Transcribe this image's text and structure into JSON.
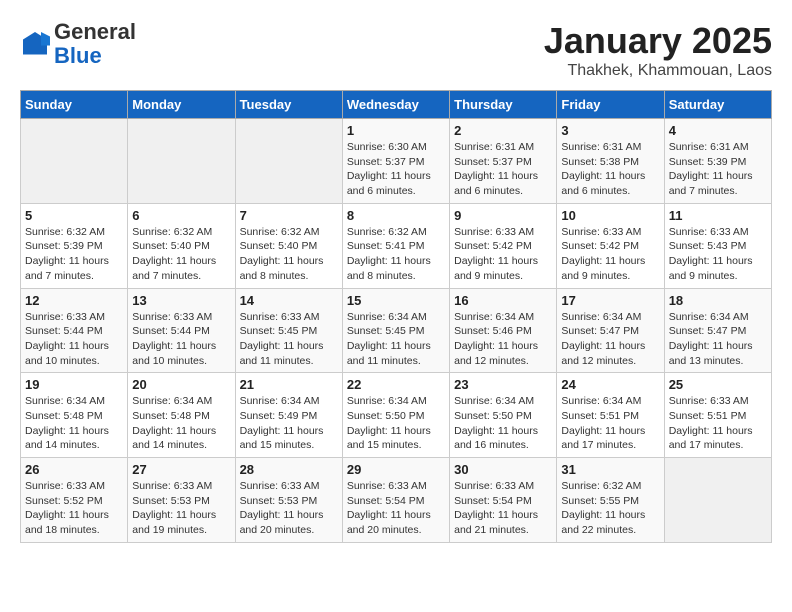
{
  "header": {
    "logo_line1": "General",
    "logo_line2": "Blue",
    "title": "January 2025",
    "subtitle": "Thakhek, Khammouan, Laos"
  },
  "weekdays": [
    "Sunday",
    "Monday",
    "Tuesday",
    "Wednesday",
    "Thursday",
    "Friday",
    "Saturday"
  ],
  "weeks": [
    [
      {
        "day": "",
        "info": ""
      },
      {
        "day": "",
        "info": ""
      },
      {
        "day": "",
        "info": ""
      },
      {
        "day": "1",
        "info": "Sunrise: 6:30 AM\nSunset: 5:37 PM\nDaylight: 11 hours\nand 6 minutes."
      },
      {
        "day": "2",
        "info": "Sunrise: 6:31 AM\nSunset: 5:37 PM\nDaylight: 11 hours\nand 6 minutes."
      },
      {
        "day": "3",
        "info": "Sunrise: 6:31 AM\nSunset: 5:38 PM\nDaylight: 11 hours\nand 6 minutes."
      },
      {
        "day": "4",
        "info": "Sunrise: 6:31 AM\nSunset: 5:39 PM\nDaylight: 11 hours\nand 7 minutes."
      }
    ],
    [
      {
        "day": "5",
        "info": "Sunrise: 6:32 AM\nSunset: 5:39 PM\nDaylight: 11 hours\nand 7 minutes."
      },
      {
        "day": "6",
        "info": "Sunrise: 6:32 AM\nSunset: 5:40 PM\nDaylight: 11 hours\nand 7 minutes."
      },
      {
        "day": "7",
        "info": "Sunrise: 6:32 AM\nSunset: 5:40 PM\nDaylight: 11 hours\nand 8 minutes."
      },
      {
        "day": "8",
        "info": "Sunrise: 6:32 AM\nSunset: 5:41 PM\nDaylight: 11 hours\nand 8 minutes."
      },
      {
        "day": "9",
        "info": "Sunrise: 6:33 AM\nSunset: 5:42 PM\nDaylight: 11 hours\nand 9 minutes."
      },
      {
        "day": "10",
        "info": "Sunrise: 6:33 AM\nSunset: 5:42 PM\nDaylight: 11 hours\nand 9 minutes."
      },
      {
        "day": "11",
        "info": "Sunrise: 6:33 AM\nSunset: 5:43 PM\nDaylight: 11 hours\nand 9 minutes."
      }
    ],
    [
      {
        "day": "12",
        "info": "Sunrise: 6:33 AM\nSunset: 5:44 PM\nDaylight: 11 hours\nand 10 minutes."
      },
      {
        "day": "13",
        "info": "Sunrise: 6:33 AM\nSunset: 5:44 PM\nDaylight: 11 hours\nand 10 minutes."
      },
      {
        "day": "14",
        "info": "Sunrise: 6:33 AM\nSunset: 5:45 PM\nDaylight: 11 hours\nand 11 minutes."
      },
      {
        "day": "15",
        "info": "Sunrise: 6:34 AM\nSunset: 5:45 PM\nDaylight: 11 hours\nand 11 minutes."
      },
      {
        "day": "16",
        "info": "Sunrise: 6:34 AM\nSunset: 5:46 PM\nDaylight: 11 hours\nand 12 minutes."
      },
      {
        "day": "17",
        "info": "Sunrise: 6:34 AM\nSunset: 5:47 PM\nDaylight: 11 hours\nand 12 minutes."
      },
      {
        "day": "18",
        "info": "Sunrise: 6:34 AM\nSunset: 5:47 PM\nDaylight: 11 hours\nand 13 minutes."
      }
    ],
    [
      {
        "day": "19",
        "info": "Sunrise: 6:34 AM\nSunset: 5:48 PM\nDaylight: 11 hours\nand 14 minutes."
      },
      {
        "day": "20",
        "info": "Sunrise: 6:34 AM\nSunset: 5:48 PM\nDaylight: 11 hours\nand 14 minutes."
      },
      {
        "day": "21",
        "info": "Sunrise: 6:34 AM\nSunset: 5:49 PM\nDaylight: 11 hours\nand 15 minutes."
      },
      {
        "day": "22",
        "info": "Sunrise: 6:34 AM\nSunset: 5:50 PM\nDaylight: 11 hours\nand 15 minutes."
      },
      {
        "day": "23",
        "info": "Sunrise: 6:34 AM\nSunset: 5:50 PM\nDaylight: 11 hours\nand 16 minutes."
      },
      {
        "day": "24",
        "info": "Sunrise: 6:34 AM\nSunset: 5:51 PM\nDaylight: 11 hours\nand 17 minutes."
      },
      {
        "day": "25",
        "info": "Sunrise: 6:33 AM\nSunset: 5:51 PM\nDaylight: 11 hours\nand 17 minutes."
      }
    ],
    [
      {
        "day": "26",
        "info": "Sunrise: 6:33 AM\nSunset: 5:52 PM\nDaylight: 11 hours\nand 18 minutes."
      },
      {
        "day": "27",
        "info": "Sunrise: 6:33 AM\nSunset: 5:53 PM\nDaylight: 11 hours\nand 19 minutes."
      },
      {
        "day": "28",
        "info": "Sunrise: 6:33 AM\nSunset: 5:53 PM\nDaylight: 11 hours\nand 20 minutes."
      },
      {
        "day": "29",
        "info": "Sunrise: 6:33 AM\nSunset: 5:54 PM\nDaylight: 11 hours\nand 20 minutes."
      },
      {
        "day": "30",
        "info": "Sunrise: 6:33 AM\nSunset: 5:54 PM\nDaylight: 11 hours\nand 21 minutes."
      },
      {
        "day": "31",
        "info": "Sunrise: 6:32 AM\nSunset: 5:55 PM\nDaylight: 11 hours\nand 22 minutes."
      },
      {
        "day": "",
        "info": ""
      }
    ]
  ]
}
